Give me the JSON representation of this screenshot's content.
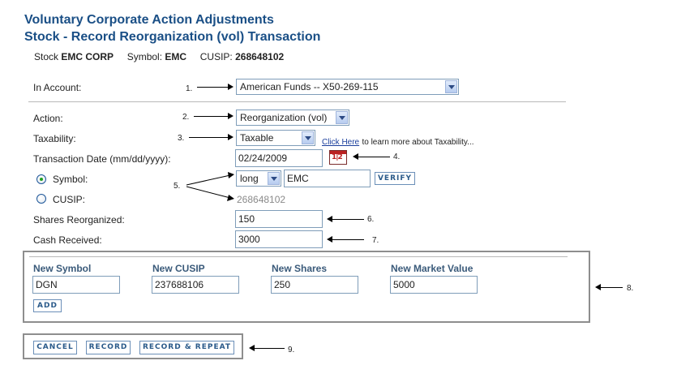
{
  "header": {
    "title": "Voluntary Corporate Action Adjustments",
    "subtitle": "Stock - Record Reorganization (vol) Transaction"
  },
  "stock": {
    "stock_label": "Stock",
    "stock_name": "EMC CORP",
    "symbol_label": "Symbol:",
    "symbol": "EMC",
    "cusip_label": "CUSIP:",
    "cusip": "268648102"
  },
  "form": {
    "account_label": "In Account:",
    "account_value": "American Funds -- X50-269-115",
    "action_label": "Action:",
    "action_value": "Reorganization (vol)",
    "taxability_label": "Taxability:",
    "taxability_value": "Taxable",
    "taxability_link": "Click Here",
    "taxability_link_tail": "to learn more about Taxability...",
    "date_label": "Transaction Date (mm/dd/yyyy):",
    "date_value": "02/24/2009",
    "symbol_radio_label": "Symbol:",
    "symbol_type_value": "long",
    "symbol_value": "EMC",
    "verify_label": "VERIFY",
    "cusip_radio_label": "CUSIP:",
    "cusip_value": "268648102",
    "shares_label": "Shares Reorganized:",
    "shares_value": "150",
    "cash_label": "Cash Received:",
    "cash_value": "3000"
  },
  "new_security": {
    "headers": [
      "New Symbol",
      "New CUSIP",
      "New Shares",
      "New Market Value"
    ],
    "values": [
      "DGN",
      "237688106",
      "250",
      "5000"
    ],
    "add_label": "ADD"
  },
  "actions": {
    "cancel_label": "CANCEL",
    "record_label": "RECORD",
    "record_repeat_label": "RECORD & REPEAT"
  },
  "callouts": [
    "1.",
    "2.",
    "3.",
    "4.",
    "5.",
    "6.",
    "7.",
    "8.",
    "9."
  ],
  "icons": {
    "calendar": "calendar-icon",
    "dropdown": "chevron-down-icon"
  },
  "colors": {
    "heading": "#1a4f86",
    "link": "#1a3e9c",
    "radio_selected": "#21a121"
  }
}
